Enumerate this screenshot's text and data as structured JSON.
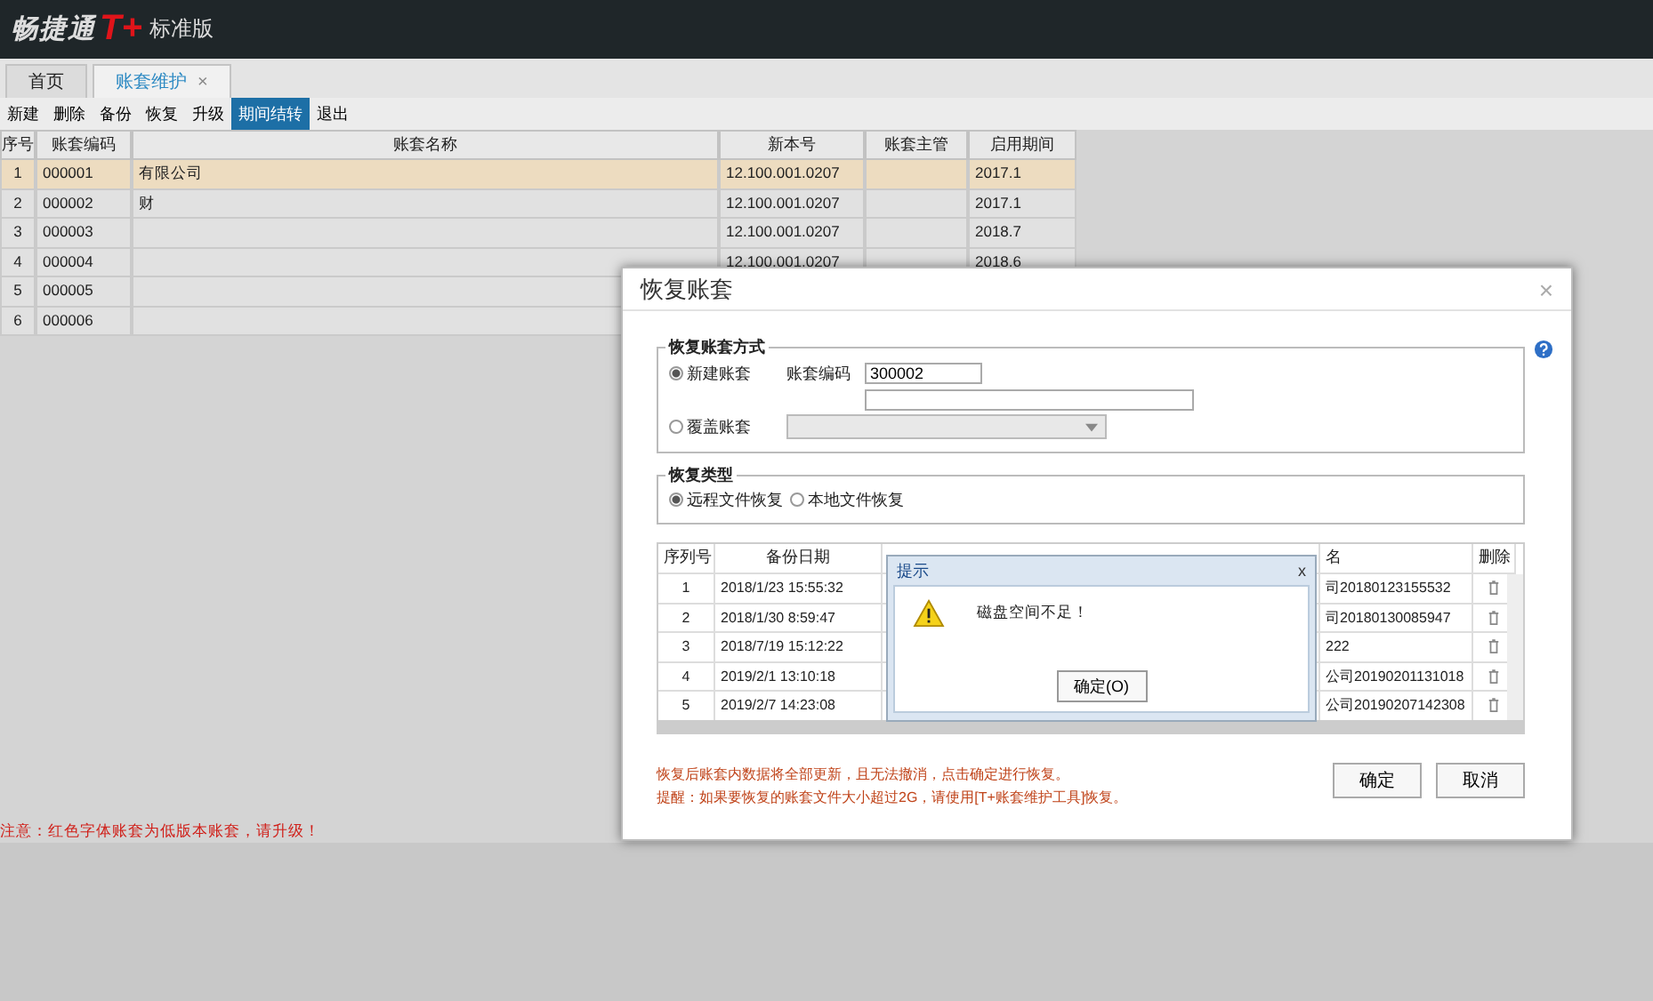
{
  "app": {
    "brand": "畅捷通",
    "mark": "T+",
    "edition": "标准版"
  },
  "tabs": [
    {
      "label": "首页",
      "selected": false
    },
    {
      "label": "账套维护",
      "selected": true,
      "close": "×"
    }
  ],
  "toolbar": [
    {
      "label": "新建",
      "selected": false
    },
    {
      "label": "删除",
      "selected": false
    },
    {
      "label": "备份",
      "selected": false
    },
    {
      "label": "恢复",
      "selected": false
    },
    {
      "label": "升级",
      "selected": false
    },
    {
      "label": "期间结转",
      "selected": true
    },
    {
      "label": "退出",
      "selected": false
    }
  ],
  "accounts": {
    "columns": [
      "序号",
      "账套编码",
      "账套名称",
      "新本号",
      "账套主管",
      "启用期间"
    ],
    "rows": [
      {
        "cells": [
          "1",
          "000001",
          "有限公司",
          "12.100.001.0207",
          "",
          "2017.1"
        ],
        "selected": true
      },
      {
        "cells": [
          "2",
          "000002",
          "财",
          "12.100.001.0207",
          "",
          "2017.1"
        ],
        "selected": false
      },
      {
        "cells": [
          "3",
          "000003",
          "",
          "12.100.001.0207",
          "",
          "2018.7"
        ],
        "selected": false
      },
      {
        "cells": [
          "4",
          "000004",
          "",
          "12.100.001.0207",
          "",
          "2018.6"
        ],
        "selected": false
      },
      {
        "cells": [
          "5",
          "000005",
          "",
          "",
          "",
          ""
        ],
        "selected": false
      },
      {
        "cells": [
          "6",
          "000006",
          "",
          "",
          "",
          ""
        ],
        "selected": false
      }
    ]
  },
  "footer_note": "注意：红色字体账套为低版本账套，请升级！",
  "dialog": {
    "title": "恢复账套",
    "close": "×",
    "method_legend": "恢复账套方式",
    "method_options": [
      {
        "label": "新建账套",
        "selected": true
      },
      {
        "label": "覆盖账套",
        "selected": false
      }
    ],
    "code_label": "账套编码",
    "code_value": "300002",
    "type_legend": "恢复类型",
    "type_options": [
      {
        "label": "远程文件恢复",
        "selected": true
      },
      {
        "label": "本地文件恢复",
        "selected": false
      }
    ],
    "backups": {
      "columns": [
        "序列号",
        "备份日期",
        "名",
        "删除"
      ],
      "rows": [
        [
          "1",
          "2018/1/23 15:55:32",
          "司20180123155532"
        ],
        [
          "2",
          "2018/1/30 8:59:47",
          "司20180130085947"
        ],
        [
          "3",
          "2018/7/19 15:12:22",
          "222"
        ],
        [
          "4",
          "2019/2/1 13:10:18",
          "公司20190201131018"
        ],
        [
          "5",
          "2019/2/7 14:23:08",
          "公司20190207142308"
        ]
      ]
    },
    "notes": [
      "恢复后账套内数据将全部更新，且无法撤消，点击确定进行恢复。",
      "提醒：如果要恢复的账套文件大小超过2G，请使用[T+账套维护工具]恢复。"
    ],
    "buttons": [
      "确定",
      "取消"
    ]
  },
  "alert": {
    "title": "提示",
    "close": "x",
    "message": "磁盘空间不足！",
    "button": "确定(O)"
  }
}
